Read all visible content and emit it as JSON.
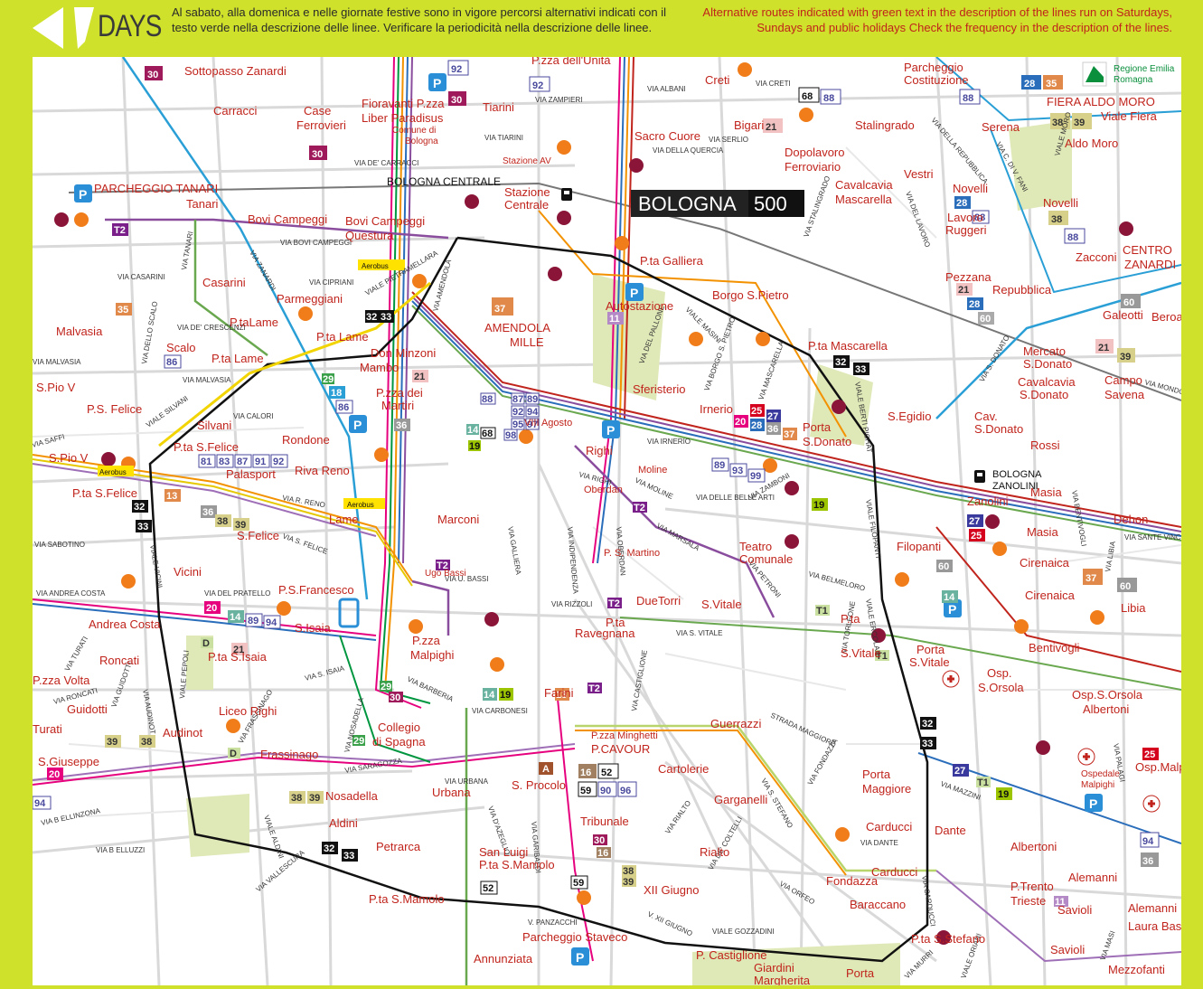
{
  "header": {
    "days_label": "DAYS",
    "note_it": "Al sabato, alla domenica e nelle giornate festive sono in vigore percorsi alternativi indicati con il testo verde nella descrizione delle linee.  Verificare la periodicità nella descrizione delle linee.",
    "note_en": "Alternative routes indicated with green text in the description of the lines run on Saturdays, Sundays and public holidays  Check the frequency in the description of the lines."
  },
  "brand": {
    "bologna": "BOLOGNA",
    "num": "500"
  },
  "region_logo": {
    "line1": "Regione Emilia",
    "line2": "Romagna"
  },
  "stations": {
    "centrale": "BOLOGNA CENTRALE",
    "zanolini_1": "BOLOGNA",
    "zanolini_2": "ZANOLINI"
  },
  "stops": [
    "Sottopasso Zanardi",
    "Carracci",
    "Case",
    "Ferrovieri",
    "Fioravanti P.zza",
    "Liber Paradisus",
    "Comune di",
    "Bologna",
    "Tiarini",
    "P.zza dell'Unità",
    "Creti",
    "Bigari",
    "Stalingrado",
    "Parcheggio",
    "Costituzione",
    "FIERA ALDO MORO",
    "Viale Fiera",
    "Aldo Moro",
    "Serena",
    "Sacro Cuore",
    "Dopolavoro",
    "Ferroviario",
    "Stazione AV",
    "Stazione",
    "Centrale",
    "PARCHEGGIO TANARI",
    "Tanari",
    "Bovi Campeggi",
    "Bovi Campeggi",
    "Questura",
    "Cavalcavia",
    "Mascarella",
    "Vestri",
    "Novelli",
    "Lavoro",
    "Ruggeri",
    "Novelli",
    "Zacconi",
    "CENTRO",
    "ZANARDI",
    "Casarini",
    "Parmeggiani",
    "P.ta Galliera",
    "Borgo S.Pietro",
    "Autostazione",
    "Pezzana",
    "Repubblica",
    "Galeotti",
    "Beroaldo",
    "Malvasia",
    "P.taLame",
    "P.ta Lame",
    "Scalo",
    "P.ta Lame",
    "Don Minzoni",
    "Mambo",
    "AMENDOLA",
    "MILLE",
    "P.ta Mascarella",
    "Mercato",
    "S.Donato",
    "Cavalcavia",
    "S.Donato",
    "Campo",
    "Savena",
    "S.Pio V",
    "P.S. Felice",
    "P.zza dei",
    "Martiri",
    "Sferisterio",
    "Irnerio",
    "S.Egidio",
    "Cav.",
    "S.Donato",
    "Rossi",
    "Silvani",
    "Rondone",
    "VIII Agosto",
    "Righi",
    "Porta",
    "S.Donato",
    "P.ta S.Felice",
    "Palasport",
    "Riva Reno",
    "Oberdan",
    "Moline",
    "S.Pio V",
    "P.ta S.Felice",
    "Lame",
    "Marconi",
    "Zanolini",
    "Masia",
    "Dehon",
    "S.Felice",
    "Teatro",
    "Comunale",
    "Masia",
    "Filopanti",
    "Cirenaica",
    "Vicini",
    "Ugo Bassi",
    "P. S. Martino",
    "Cirenaica",
    "P.S.Francesco",
    "DueTorri",
    "S.Vitale",
    "Libia",
    "Andrea Costa",
    "S.Isaia",
    "P.zza",
    "Malpighi",
    "P.ta",
    "Ravegnana",
    "P.ta",
    "S.Vitale",
    "Bentivogli",
    "P.ta S.Isaia",
    "Roncati",
    "Porta",
    "S.Vitale",
    "Osp.",
    "S.Orsola",
    "Osp.S.Orsola",
    "Albertoni",
    "P.zza Volta",
    "Guidotti",
    "Liceo Righi",
    "Farini",
    "Turati",
    "Audinot",
    "Collegio",
    "di Spagna",
    "Guerrazzi",
    "Frassinago",
    "P.zza Minghetti",
    "P.CAVOUR",
    "Cartolerie",
    "S.Giuseppe",
    "Nosadella",
    "Urbana",
    "S. Procolo",
    "Porta",
    "Maggiore",
    "Osp.Malpighi",
    "Ospedale",
    "Malpighi",
    "Garganelli",
    "Tribunale",
    "Aldini",
    "Carducci",
    "Dante",
    "Petrarca",
    "San Luigi",
    "P.ta S.Mamolo",
    "Rialto",
    "Carducci",
    "Fondazza",
    "Albertoni",
    "Alemanni",
    "P.Trento",
    "Trieste",
    "Savioli",
    "XII Giugno",
    "Baraccano",
    "Alemanni",
    "Laura Bassi",
    "P.ta S.Mamolo",
    "Parcheggio Staveco",
    "P.ta S.Stefano",
    "Savioli",
    "Annunziata",
    "P. Castiglione",
    "Giardini",
    "Margherita",
    "Porta",
    "Mezzofanti"
  ],
  "streets": [
    "VIA ZAMPIERI",
    "VIA ALBANI",
    "VIA CRETI",
    "VIA TIARINI",
    "VIA SERLIO",
    "VIA DELLA QUERCIA",
    "VIA DE' CARRACCI",
    "VIA BOVI CAMPEGGI",
    "VIA CASARINI",
    "VIA TANARI",
    "VIA ZANARDI",
    "VIA CIPRIANI",
    "VIALE PIETRAMELLARA",
    "VIA AMENDOLA",
    "VIA DE' CRESCENZI",
    "VIA MALVASIA",
    "VIA DELLO SCALO",
    "VIA MALVASIA",
    "VIALE MASINI",
    "VIA DEL PALLONE",
    "VIA BORGO S. PIETRO",
    "VIA MASCARELLA",
    "VIA STALINGRADO",
    "VIALE BERTI PICHAT",
    "VIA CALORI",
    "VIALE SILVANI",
    "VIA SAFFI",
    "VIA IRNERIO",
    "VIA RIGHI",
    "VIA MOLINE",
    "VIA DELLE BELLE ARTI",
    "VIA GALLIERA",
    "VIA INDIPENDENZA",
    "VIA OBERDAN",
    "VIA MARSALA",
    "VIA ZAMBONI",
    "VIA PETRONI",
    "VIA BELMELORO",
    "VIALE FILOPANTI",
    "VIA SABOTINO",
    "VIA R. RENO",
    "VIA S. FELICE",
    "VIALE VICINI",
    "VIA ANDREA COSTA",
    "VIA DEL PRATELLO",
    "VIA U. BASSI",
    "VIA RIZZOLI",
    "VIA S. VITALE",
    "STRADA MAGGIORE",
    "VIA S. ISAIA",
    "VIA BARBERIA",
    "VIA CARBONESI",
    "VIA CASTIGLIONE",
    "VIALE PEPOLI",
    "VIA AUDINOT",
    "VIA TURATI",
    "VIA RONCATI",
    "VIA GUIDOTTI",
    "VIA FRASSINAGO",
    "VIA NOSADELLA",
    "VIA SARAGOZZA",
    "VIA URBANA",
    "VIA D'AZEGLIO",
    "VIA GARIBALDI",
    "VIA S. STEFANO",
    "VIA FONDAZZA",
    "VIA DANTE",
    "VIALE ALDINI",
    "VIA VALLESCURA",
    "VIA B ELLUZZI",
    "VIA B ELLINZONA",
    "VIALE GOZZADINI",
    "V. PANZACCHI",
    "V. XII GIUGNO",
    "VIA ORFEO",
    "VIA DE' COLTELLI",
    "VIA RIALTO",
    "VIA MAZZINI",
    "VIA MURRI",
    "VIALE ORIANI",
    "VIA MASI",
    "VIA SANTE VINCENZI",
    "VIA LIBIA",
    "VIA BENTIVOGLI",
    "VIA PALAGI",
    "VIALE ERCOLANI",
    "VIA TORLEONE",
    "VIA CARDUCCI",
    "VIA DELLA REPUBBLICA",
    "VIA DEL LAVORO",
    "VIA S. DONATO",
    "VIA MONDO",
    "VIA C. DI V. FANI",
    "VIALE MORO"
  ],
  "route_badges": [
    "30",
    "92",
    "30",
    "30",
    "92",
    "68",
    "88",
    "21",
    "88",
    "28",
    "35",
    "38",
    "39",
    "38",
    "88",
    "28",
    "88",
    "21",
    "28",
    "60",
    "60",
    "21",
    "39",
    "T2",
    "37",
    "11",
    "35",
    "86",
    "33",
    "32",
    "18",
    "29",
    "86",
    "21",
    "36",
    "88",
    "89",
    "93",
    "99",
    "87",
    "89",
    "92",
    "94",
    "95",
    "97",
    "98",
    "68",
    "14",
    "19",
    "25",
    "27",
    "20",
    "28",
    "36",
    "37",
    "32",
    "33",
    "13",
    "36",
    "38",
    "39",
    "32",
    "33",
    "81",
    "83",
    "87",
    "91",
    "92",
    "19",
    "27",
    "25",
    "60",
    "14",
    "37",
    "60",
    "T1",
    "20",
    "14",
    "89",
    "94",
    "21",
    "T2",
    "T2",
    "T2",
    "T1",
    "29",
    "30",
    "14",
    "19",
    "13",
    "T2",
    "16",
    "52",
    "59",
    "90",
    "96",
    "A",
    "30",
    "16",
    "38",
    "39",
    "59",
    "52",
    "32",
    "33",
    "27",
    "T1",
    "19",
    "25",
    "94",
    "36",
    "11",
    "29",
    "38",
    "39",
    "94",
    "20",
    "39",
    "38",
    "32",
    "33",
    "D",
    "D",
    "18"
  ],
  "airport_label": "Aerobus"
}
